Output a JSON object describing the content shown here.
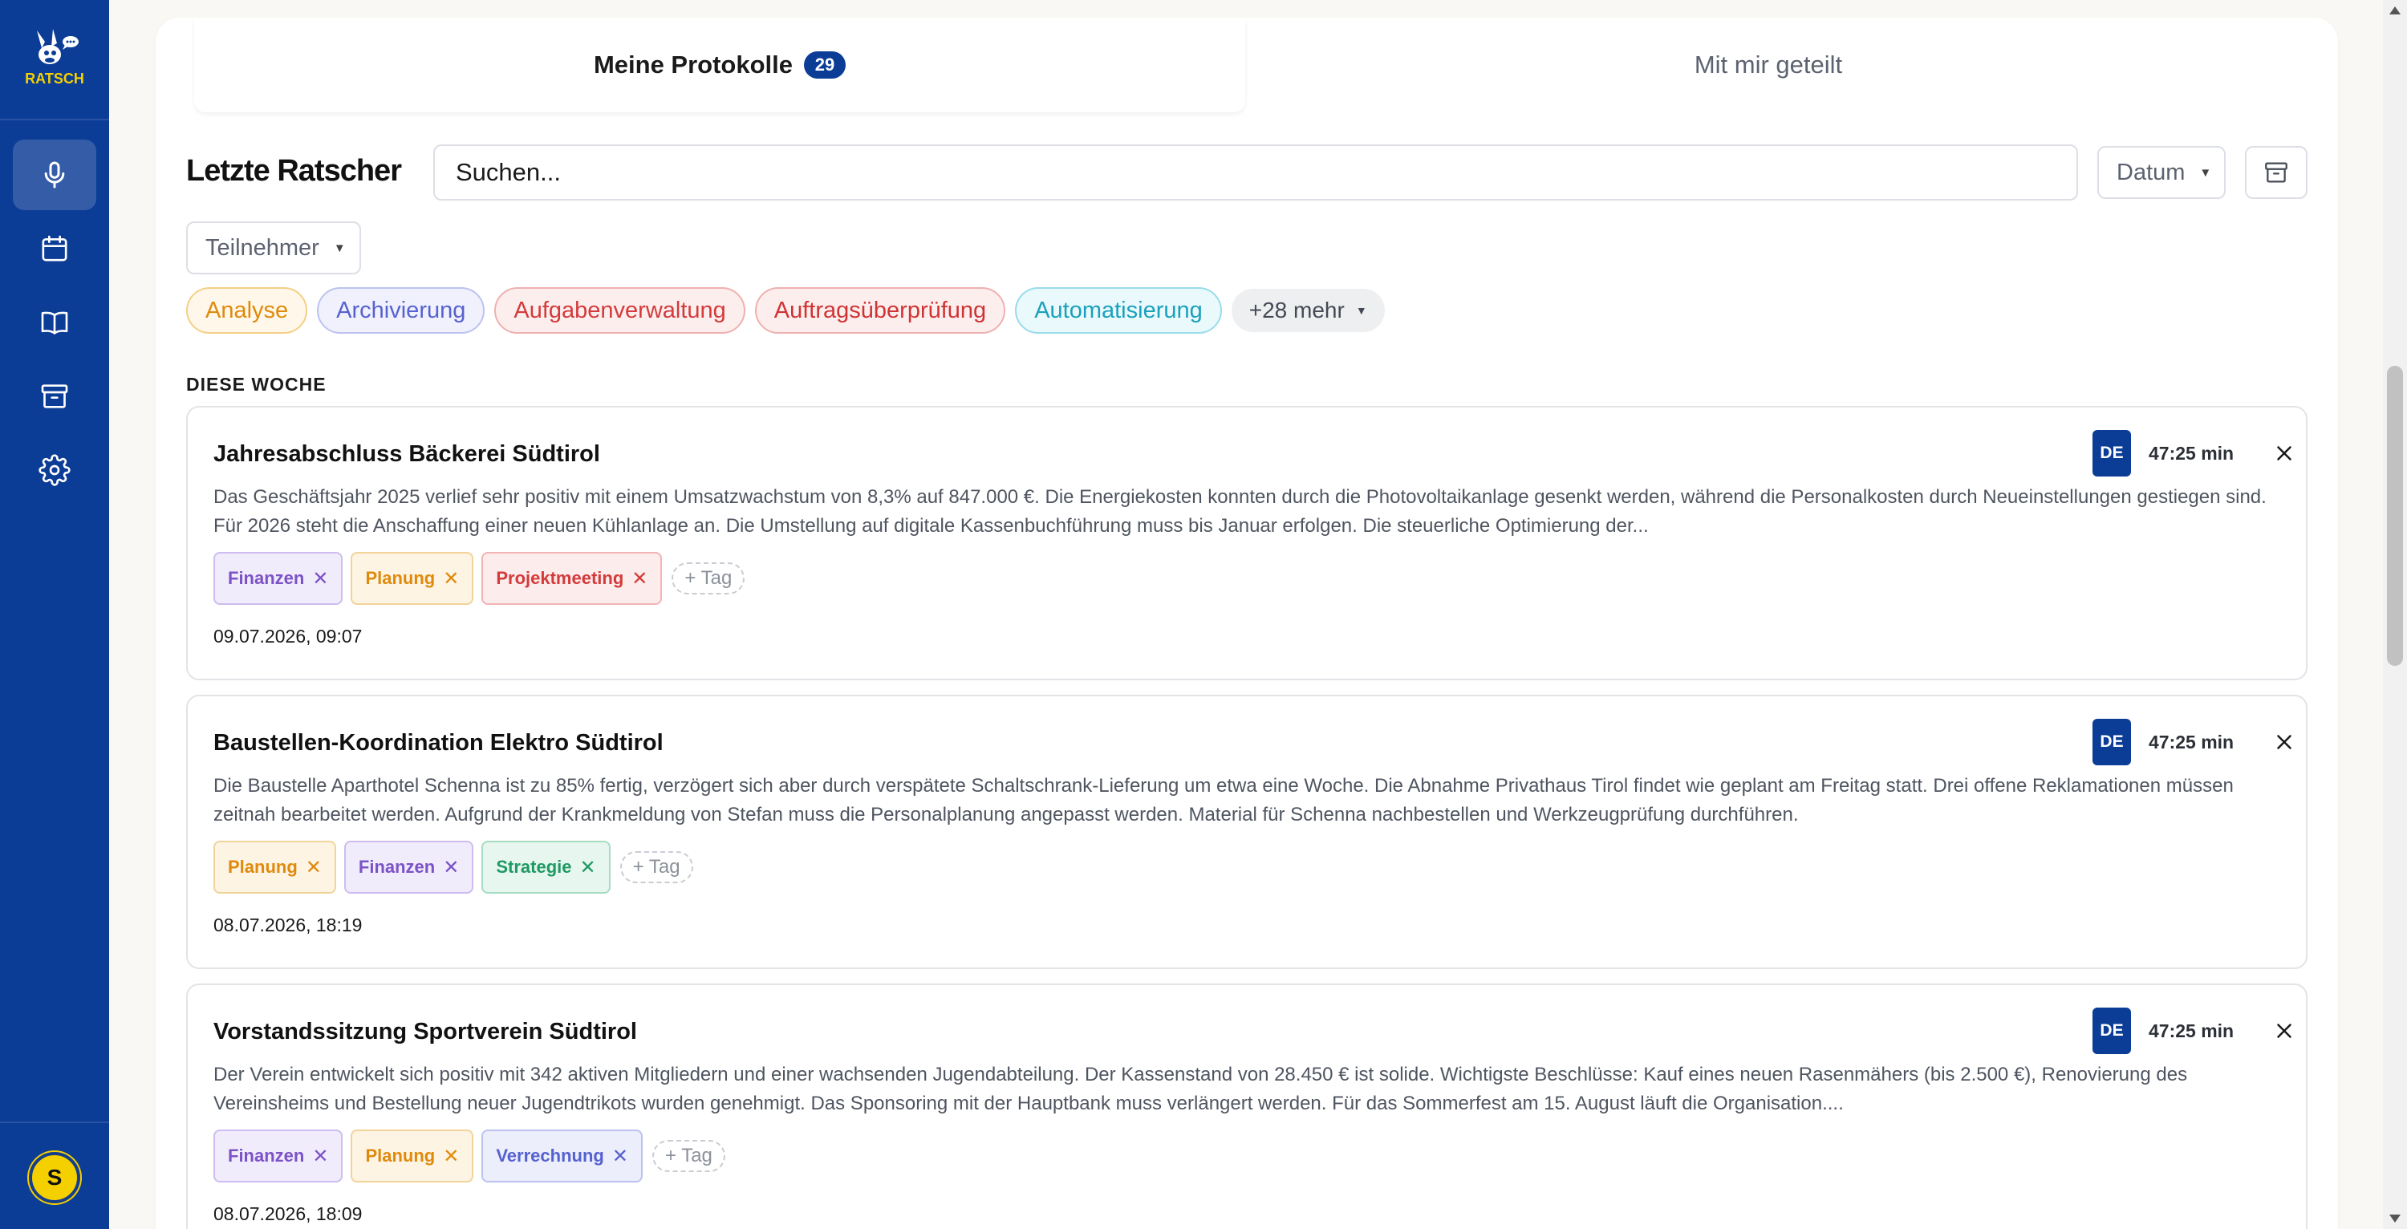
{
  "app": {
    "logo_text": "RATSCH"
  },
  "sidebar": {
    "items": [
      {
        "name": "record",
        "icon": "microphone-icon",
        "active": true
      },
      {
        "name": "calendar",
        "icon": "calendar-icon",
        "active": false
      },
      {
        "name": "library",
        "icon": "book-icon",
        "active": false
      },
      {
        "name": "archive",
        "icon": "archive-icon",
        "active": false
      },
      {
        "name": "settings",
        "icon": "gear-icon",
        "active": false
      }
    ],
    "user_initial": "S"
  },
  "tabs": {
    "mine_label": "Meine Protokolle",
    "mine_count": "29",
    "shared_label": "Mit mir geteilt"
  },
  "toolbar": {
    "title": "Letzte Ratscher",
    "search_placeholder": "Suchen...",
    "date_sort_label": "Datum",
    "participants_label": "Teilnehmer"
  },
  "filters": {
    "tags": [
      "Analyse",
      "Archivierung",
      "Aufgabenverwaltung",
      "Auftragsüberprüfung",
      "Automatisierung"
    ],
    "more_label": "+28 mehr"
  },
  "section_label": "DIESE WOCHE",
  "protocols": [
    {
      "title": "Jahresabschluss Bäckerei Südtirol",
      "language": "DE",
      "duration": "47:25 min",
      "summary": "Das Geschäftsjahr 2025 verlief sehr positiv mit einem Umsatzwachstum von 8,3% auf 847.000 €. Die Energiekosten konnten durch die Photovoltaikanlage gesenkt werden, während die Personalkosten durch Neueinstellungen gestiegen sind. Für 2026 steht die Anschaffung einer neuen Kühlanlage an. Die Umstellung auf digitale Kassenbuchführung muss bis Januar erfolgen. Die steuerliche Optimierung der...",
      "tags": [
        "Finanzen",
        "Planung",
        "Projektmeeting"
      ],
      "add_tag_label": "+ Tag",
      "date": "09.07.2026, 09:07"
    },
    {
      "title": "Baustellen-Koordination Elektro Südtirol",
      "language": "DE",
      "duration": "47:25 min",
      "summary": "Die Baustelle Aparthotel Schenna ist zu 85% fertig, verzögert sich aber durch verspätete Schaltschrank-Lieferung um etwa eine Woche. Die Abnahme Privathaus Tirol findet wie geplant am Freitag statt. Drei offene Reklamationen müssen zeitnah bearbeitet werden. Aufgrund der Krankmeldung von Stefan muss die Personalplanung angepasst werden. Material für Schenna nachbestellen und Werkzeugprüfung durchführen.",
      "tags": [
        "Planung",
        "Finanzen",
        "Strategie"
      ],
      "add_tag_label": "+ Tag",
      "date": "08.07.2026, 18:19"
    },
    {
      "title": "Vorstandssitzung Sportverein Südtirol",
      "language": "DE",
      "duration": "47:25 min",
      "summary": "Der Verein entwickelt sich positiv mit 342 aktiven Mitgliedern und einer wachsenden Jugendabteilung. Der Kassenstand von 28.450 € ist solide. Wichtigste Beschlüsse: Kauf eines neuen Rasenmähers (bis 2.500 €), Renovierung des Vereinsheims und Bestellung neuer Jugendtrikots wurden genehmigt. Das Sponsoring mit der Hauptbank muss verlängert werden. Für das Sommerfest am 15. August läuft die Organisation....",
      "tags": [
        "Finanzen",
        "Planung",
        "Verrechnung"
      ],
      "add_tag_label": "+ Tag",
      "date": "08.07.2026, 18:09"
    }
  ],
  "colors": {
    "brand": "#0b3c96",
    "avatar": "#f5d000"
  }
}
